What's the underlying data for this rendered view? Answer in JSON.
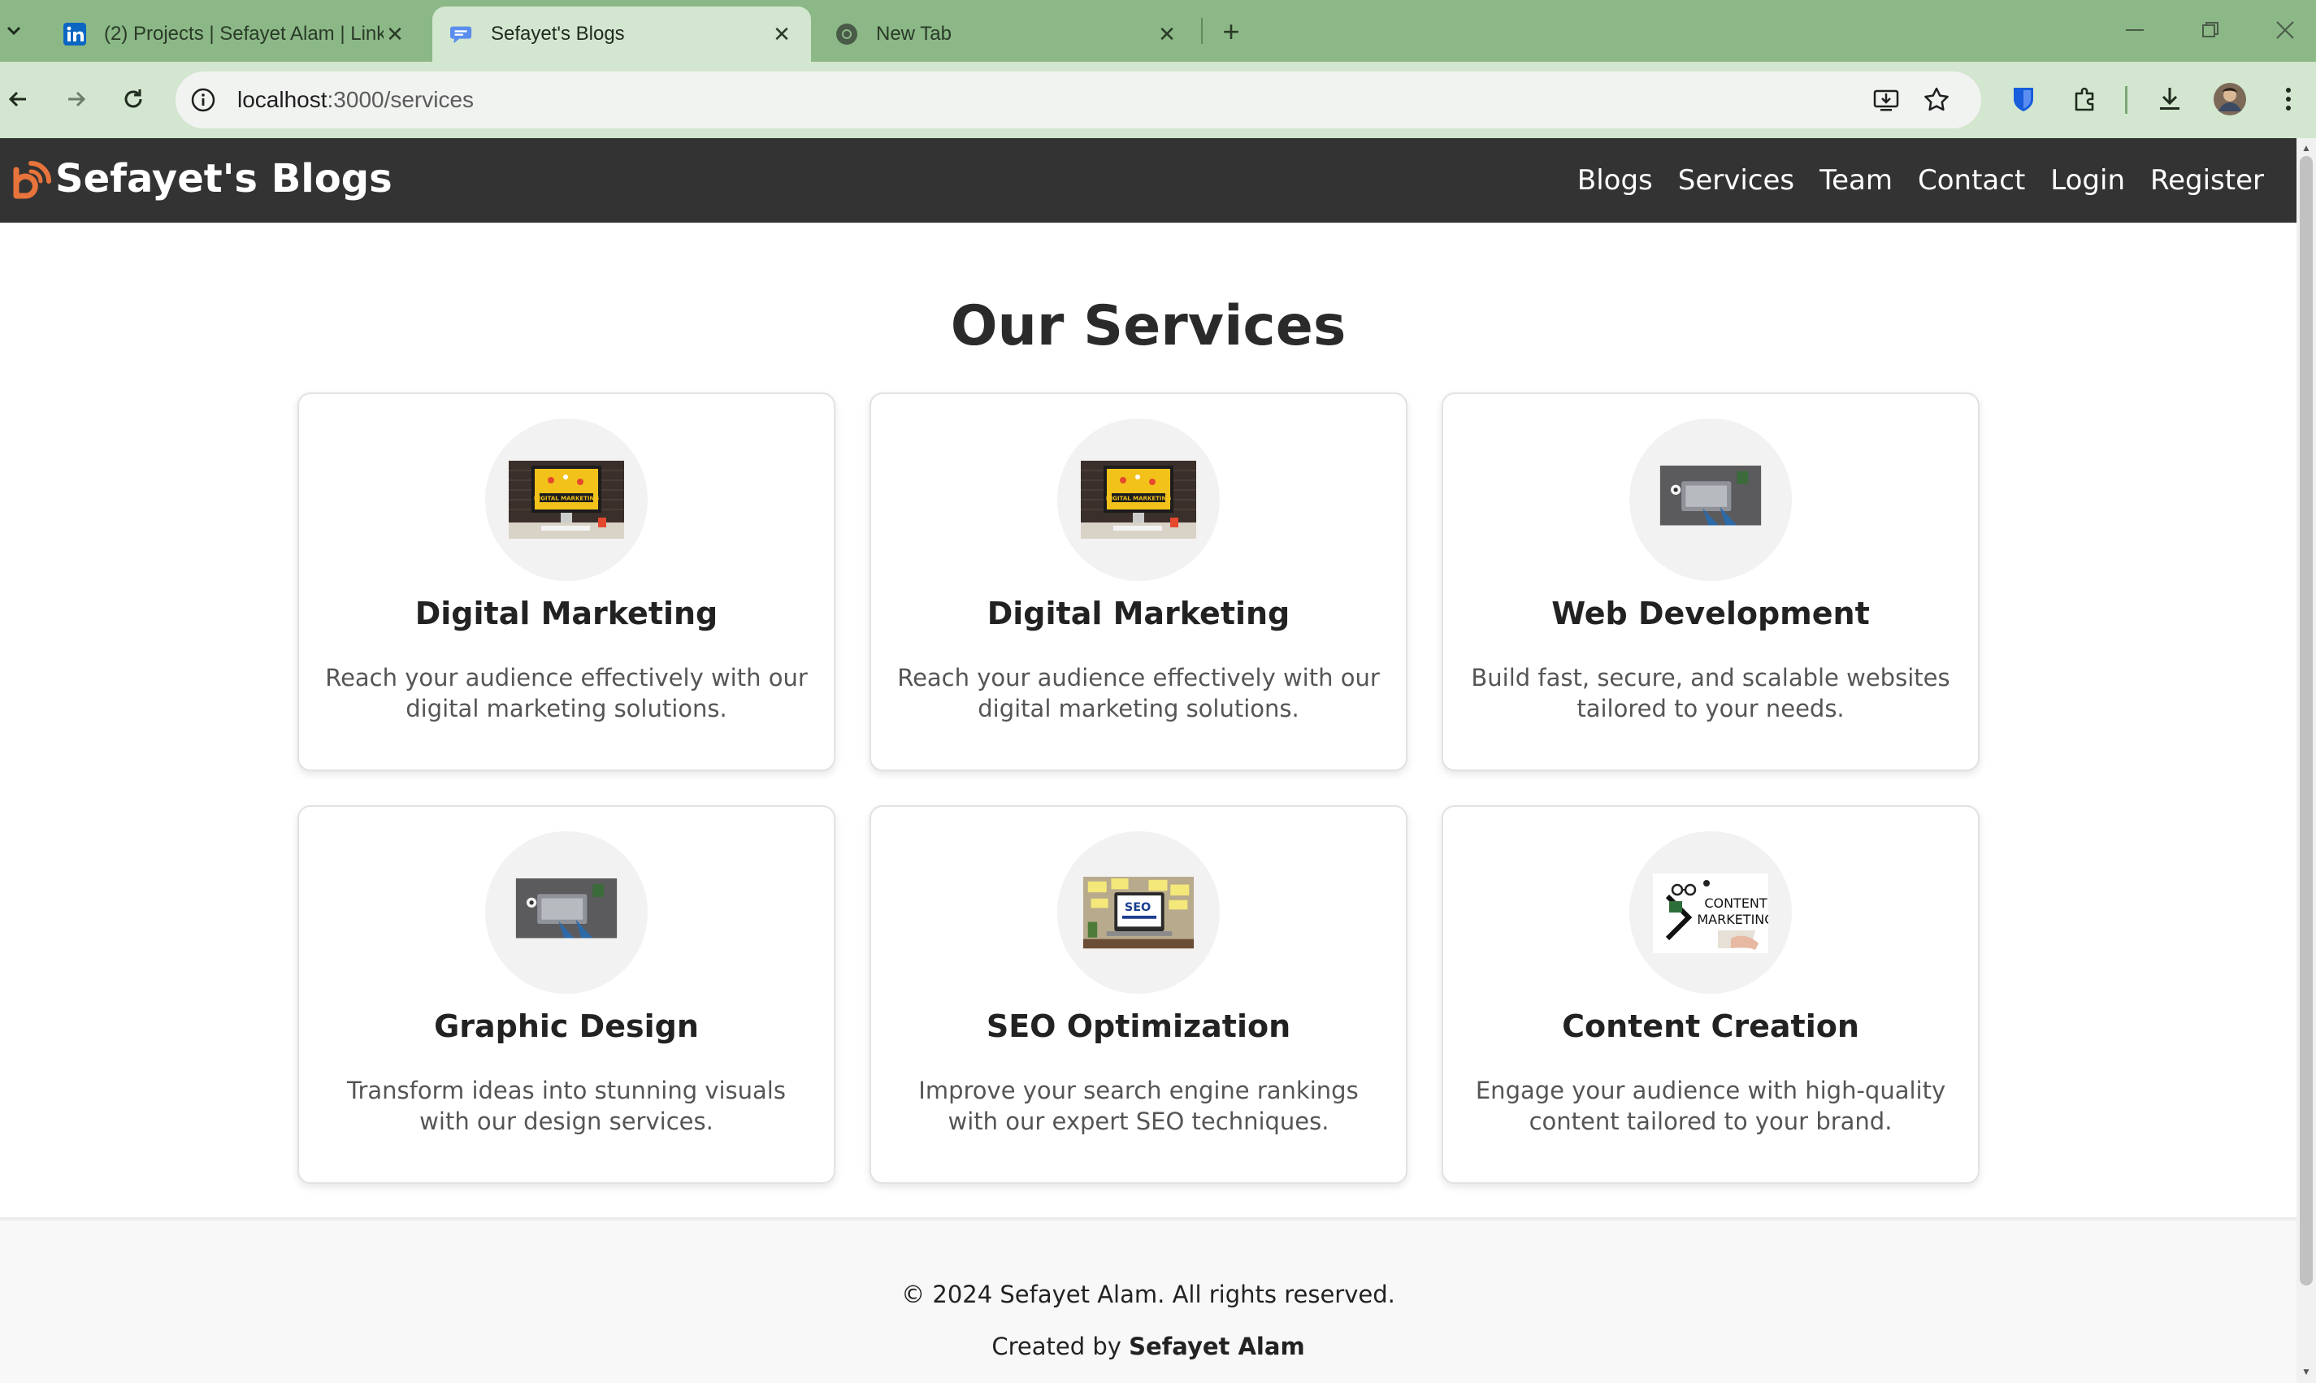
{
  "browser": {
    "tabs": [
      {
        "title": "(2) Projects | Sefayet Alam | LinkedIn",
        "icon": "linkedin-icon"
      },
      {
        "title": "Sefayet's Blogs",
        "icon": "chat-bubble-icon",
        "active": true
      },
      {
        "title": "New Tab",
        "icon": "chrome-icon"
      }
    ],
    "close_glyph": "✕",
    "new_tab_glyph": "+",
    "url_host": "localhost",
    "url_path": ":3000/services"
  },
  "site": {
    "brand": "Sefayet's Blogs",
    "nav": [
      "Blogs",
      "Services",
      "Team",
      "Contact",
      "Login",
      "Register"
    ],
    "heading": "Our Services",
    "services": [
      {
        "title": "Digital Marketing",
        "desc": "Reach your audience effectively with our digital marketing solutions.",
        "image": "digital-marketing-image"
      },
      {
        "title": "Digital Marketing",
        "desc": "Reach your audience effectively with our digital marketing solutions.",
        "image": "digital-marketing-image"
      },
      {
        "title": "Web Development",
        "desc": "Build fast, secure, and scalable websites tailored to your needs.",
        "image": "desk-laptop-image"
      },
      {
        "title": "Graphic Design",
        "desc": "Transform ideas into stunning visuals with our design services.",
        "image": "desk-laptop-image"
      },
      {
        "title": "SEO Optimization",
        "desc": "Improve your search engine rankings with our expert SEO techniques.",
        "image": "seo-image"
      },
      {
        "title": "Content Creation",
        "desc": "Engage your audience with high-quality content tailored to your brand.",
        "image": "content-marketing-image"
      }
    ],
    "image_labels": {
      "digital_marketing": "DIGITAL MARKETING",
      "seo": "SEO",
      "content_1": "CONTENT",
      "content_2": "MARKETING"
    },
    "footer": {
      "copyright": "© 2024 Sefayet Alam. All rights reserved.",
      "created_prefix": "Created by ",
      "created_name": "Sefayet Alam"
    }
  },
  "colors": {
    "tab_bar": "#8bb886",
    "toolbar": "#d3e6cf",
    "site_nav": "#333333",
    "brand_icon": "#e8743b"
  }
}
